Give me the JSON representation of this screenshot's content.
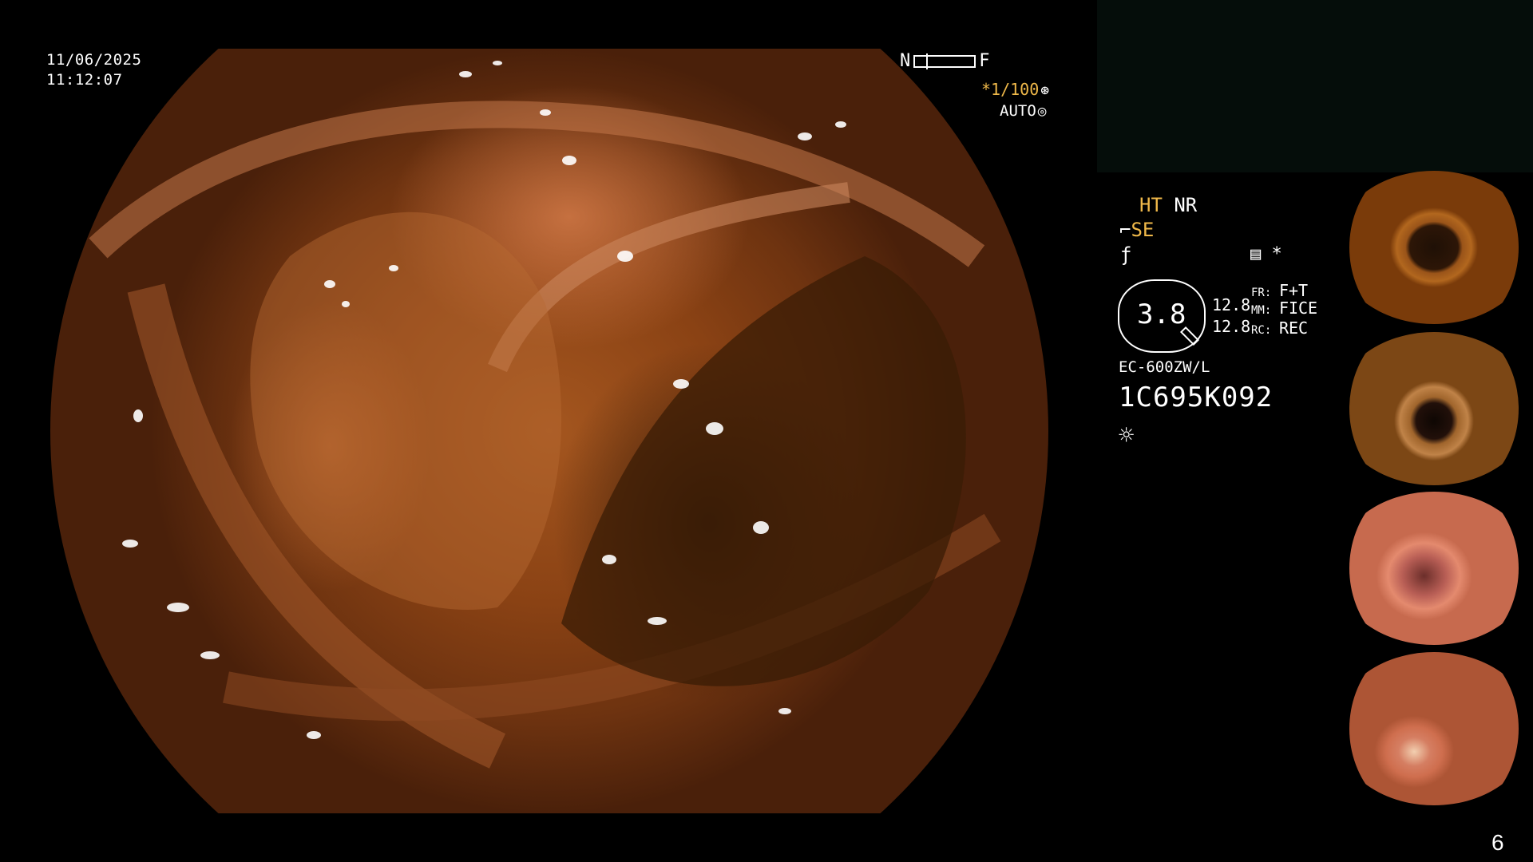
{
  "screen": {
    "date": "11/06/2025",
    "time": "11:12:07",
    "nf_left": "N",
    "nf_right": "F",
    "shutter": "*1/100",
    "shutter_icon": "aperture-icon",
    "auto_label": "AUTO",
    "auto_icon": "iris-icon",
    "ht_label": "HT",
    "nr_label": "NR",
    "se_label": "SE",
    "enhancement_value": "3.8",
    "enh_1": "12.8",
    "enh_2": "12.8",
    "fr_label": "FR:",
    "fr_value": "F+T",
    "mm_label": "MM:",
    "mm_value": "FICE",
    "rc_label": "RC:",
    "rc_value": "REC",
    "star": "*",
    "model": "EC-600ZW/L",
    "serial": "1C695K092",
    "page_number": "6"
  },
  "colors": {
    "overlay_text": "#ffffff",
    "highlight_text": "#f0b94a",
    "background": "#000000",
    "top_right_panel": "#050d0a"
  },
  "thumbnails": [
    {
      "name": "thumbnail-1"
    },
    {
      "name": "thumbnail-2"
    },
    {
      "name": "thumbnail-3"
    },
    {
      "name": "thumbnail-4"
    }
  ]
}
